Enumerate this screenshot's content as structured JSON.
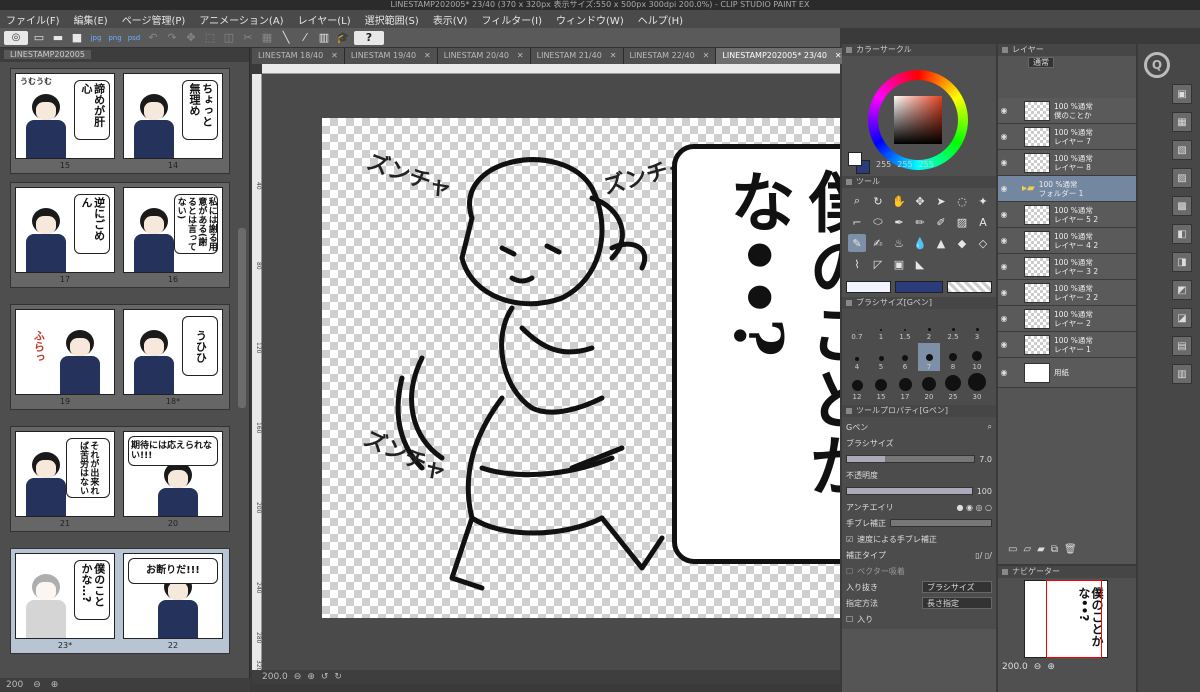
{
  "window": {
    "title": "LINESTAMP202005* 23/40 (370 x 320px 表示サイズ:550 x 500px 300dpi 200.0%) - CLIP STUDIO PAINT EX"
  },
  "menu": [
    "ファイル(F)",
    "編集(E)",
    "ページ管理(P)",
    "アニメーション(A)",
    "レイヤー(L)",
    "選択範囲(S)",
    "表示(V)",
    "フィルター(I)",
    "ウィンドウ(W)",
    "ヘルプ(H)"
  ],
  "toolbar": {
    "badges": [
      "jpg",
      "png",
      "psd"
    ]
  },
  "pagepanel": {
    "tab": "LINESTAMP202005",
    "spreads": [
      {
        "left": {
          "num": "15",
          "text": "諦めが肝心",
          "side": "うむうむ"
        },
        "right": {
          "num": "14",
          "text": "ちょっと無理め"
        }
      },
      {
        "left": {
          "num": "17",
          "text": "逆にごめん"
        },
        "right": {
          "num": "16",
          "text": "私には謝る用意がある(謝るとは言ってない)"
        }
      },
      {
        "left": {
          "num": "19",
          "text": "ふらっ"
        },
        "right": {
          "num": "18*",
          "text": "うひひ"
        }
      },
      {
        "left": {
          "num": "21",
          "text": "それが出来れば苦労はない"
        },
        "right": {
          "num": "20",
          "text": "期待には応えられない!!!"
        }
      },
      {
        "left": {
          "num": "23*",
          "text": "僕のことかな…?"
        },
        "right": {
          "num": "22",
          "text": "お断りだ!!!"
        }
      }
    ],
    "zoom": "200"
  },
  "doctabs": [
    "LINESTAM 18/40",
    "LINESTAM 19/40",
    "LINESTAM 20/40",
    "LINESTAM 21/40",
    "LINESTAM 22/40",
    "LINESTAMP202005* 23/40"
  ],
  "canvas": {
    "ruler": [
      "40",
      "80",
      "120",
      "160",
      "200",
      "240",
      "280",
      "320"
    ],
    "bubble_text": "僕のことかな••?",
    "sfx": [
      "ズンチャ",
      "ズンチャ",
      "ズンチャ"
    ],
    "zoom": "200.0"
  },
  "colorpanel": {
    "title": "カラーサークル",
    "r": "255",
    "g": "255",
    "b": "255"
  },
  "toolpanel": {
    "title": "ツール"
  },
  "brushsize": {
    "title": "ブラシサイズ[Gペン]",
    "sizes": [
      "0.7",
      "1",
      "1.5",
      "2",
      "2.5",
      "3",
      "4",
      "5",
      "6",
      "7",
      "8",
      "10",
      "12",
      "15",
      "17",
      "20",
      "25",
      "30"
    ]
  },
  "toolprop": {
    "title": "ツールプロパティ[Gペン]",
    "tool": "Gペン",
    "brushsize_label": "ブラシサイズ",
    "brushsize_val": "7.0",
    "opacity_label": "不透明度",
    "opacity_val": "100",
    "aa_label": "アンチエイリ",
    "stab_label": "手ブレ補正",
    "speed_label": "速度による手ブレ補正",
    "type_label": "補正タイプ",
    "vector_label": "ベクター吸着",
    "inout_label": "入り抜き",
    "inout_val": "ブラシサイズ",
    "method_label": "指定方法",
    "method_val": "長さ指定",
    "in_label": "入り"
  },
  "layers": {
    "title": "レイヤー",
    "blend": "通常",
    "items": [
      {
        "name": "100 %通常\n僕のことか"
      },
      {
        "name": "100 %通常\nレイヤー 7"
      },
      {
        "name": "100 %通常\nレイヤー 8"
      },
      {
        "name": "100 %通常\nフォルダー 1"
      },
      {
        "name": "100 %通常\nレイヤー 5 2"
      },
      {
        "name": "100 %通常\nレイヤー 4 2"
      },
      {
        "name": "100 %通常\nレイヤー 3 2"
      },
      {
        "name": "100 %通常\nレイヤー 2 2"
      },
      {
        "name": "100 %通常\nレイヤー 2"
      },
      {
        "name": "100 %通常\nレイヤー 1"
      },
      {
        "name": "用紙"
      }
    ]
  },
  "navigator": {
    "title": "ナビゲーター",
    "zoom": "200.0",
    "preview_text": "僕のことかな••?"
  },
  "colors": {
    "accent": "#7387a0",
    "bg": "#3a3a3a"
  }
}
